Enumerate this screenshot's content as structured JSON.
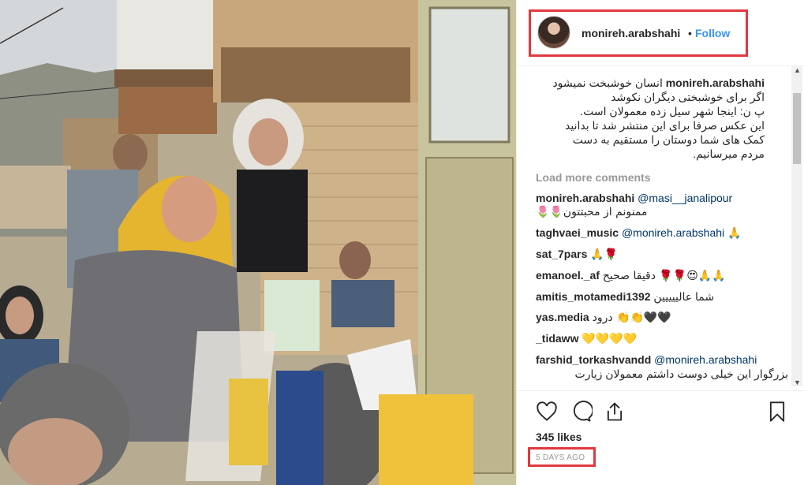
{
  "post": {
    "username": "monireh.arabshahi",
    "separator": "•",
    "follow_label": "Follow",
    "caption_user": "monireh.arabshahi",
    "caption_lines": [
      "انسان خوشبخت نمیشود",
      "اگر برای خوشبختی دیگران نکوشد",
      "پ ن: اینجا شهر سیل زده معمولان است.",
      "این عکس صرفا برای این منتشر شد تا بدانید",
      "کمک های شما دوستان را مستقیم به دست",
      "مردم میرسانیم."
    ],
    "load_more_label": "Load more comments",
    "comments": [
      {
        "user": "monireh.arabshahi",
        "mention": "@masi__janalipour",
        "text": "🌷🌷ممنونم از محبتتون"
      },
      {
        "user": "taghvaei_music",
        "mention": "@monireh.arabshahi",
        "text": "🙏"
      },
      {
        "user": "sat_7pars",
        "mention": "",
        "text": "🙏🌹"
      },
      {
        "user": "emanoel._af",
        "mention": "",
        "text": "دقیقا صحیح 🌹🌹😍🙏🙏"
      },
      {
        "user": "amitis_motamedi1392",
        "mention": "",
        "text": "شما عالییییین"
      },
      {
        "user": "yas.media",
        "mention": "",
        "text": "درود 👏👏🖤🖤"
      },
      {
        "user": "_tidaww",
        "mention": "",
        "text": "💛💛💛💛"
      },
      {
        "user": "farshid_torkashvandd",
        "mention": "@monireh.arabshahi",
        "text": "بزرگوار این خیلی دوست داشتم معمولان زیارت"
      }
    ],
    "likes": "345 likes",
    "timestamp": "5 DAYS AGO"
  },
  "icons": {
    "like": "heart-icon",
    "comment": "comment-icon",
    "share": "share-icon",
    "save": "bookmark-icon"
  },
  "colors": {
    "follow": "#3897f0",
    "highlight": "#e0393f",
    "muted": "#999999",
    "text": "#262626"
  }
}
